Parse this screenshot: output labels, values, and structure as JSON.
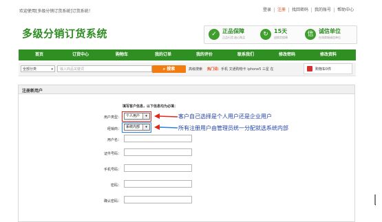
{
  "topbar": {
    "welcome": "欢迎使用[多级分销订货系统]订货系统！",
    "links": [
      "登录",
      "注册",
      "找回密码",
      "我的账号",
      "帮助中心"
    ]
  },
  "header": {
    "logo": "多级分销订货系统",
    "features": [
      {
        "icon": "✓",
        "title": "正品保障",
        "sub": "正品行货 放心购买"
      },
      {
        "icon": "↻",
        "title": "15天",
        "sub": "退换货保障"
      },
      {
        "icon": "信",
        "title": "诚信单位",
        "sub": "在线商城诚信单位"
      }
    ]
  },
  "nav": [
    "首页",
    "订货中心",
    "购物车",
    "我的订单",
    "我的评价",
    "联系我们",
    "修改密码",
    "修改资料"
  ],
  "search": {
    "category": "全部分类",
    "placeholder": "输入商品关键词",
    "button": "搜索",
    "advanced": "高级搜索",
    "hot_label": "热门词：",
    "hot_words": "手机 文通购物卡 iphone5 三星 在",
    "cart": "购物车0件"
  },
  "form": {
    "title": "注册新用户",
    "hint": "填写客户信息，以下信息均为必填：",
    "fields": {
      "user_type_label": "用户类型：",
      "user_type_value": "个人用户",
      "dealer_label": "经销商：",
      "dealer_value": "系统内部",
      "username_label": "用户名：",
      "id_label": "证件号码：",
      "phone_label": "手机号码：",
      "password_label": "密码：",
      "confirm_label": "确认密码："
    }
  },
  "annotations": {
    "note1": "客户自己选择是个人用户还是企业用户",
    "note2": "所有注册用户由管理员统一分配就选系统内部"
  },
  "colors": {
    "brand_green": "#2f8f22",
    "accent_orange": "#f07c12",
    "annotation_red": "#e0261b",
    "annotation_blue": "#1f3fa6"
  }
}
